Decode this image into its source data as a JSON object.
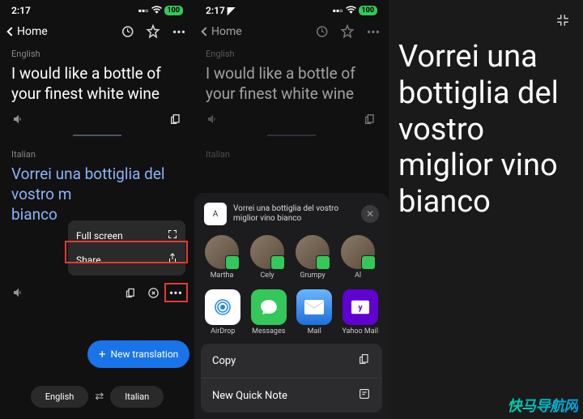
{
  "panel1": {
    "status_time": "2:17",
    "battery": "100",
    "nav_back": "Home",
    "src_lang_label": "English",
    "src_text": "I would like a bottle of your finest white wine",
    "tgt_lang_label": "Italian",
    "tgt_text_visible": "Vorrei una bottiglia del vostro m····· ····· bianco",
    "tgt_text_full": "Vorrei una bottiglia del vostro miglior vino bianco",
    "menu": {
      "fullscreen": "Full screen",
      "share": "Share"
    },
    "new_translation": "New translation",
    "lang_left": "English",
    "lang_right": "Italian"
  },
  "panel2": {
    "status_time": "2:17",
    "battery": "100",
    "nav_back": "Home",
    "src_lang_label": "English",
    "src_text": "I would like a bottle of your finest white wine",
    "tgt_lang_label": "Italian",
    "sheet_title": "Vorrei una bottiglia del vostro miglior vino bianco",
    "contacts": [
      "Martha",
      "Cely",
      "Grumpy",
      "Al"
    ],
    "apps": [
      {
        "name": "AirDrop"
      },
      {
        "name": "Messages"
      },
      {
        "name": "Mail"
      },
      {
        "name": "Yahoo Mail"
      }
    ],
    "action_copy": "Copy",
    "action_quicknote": "New Quick Note"
  },
  "panel3": {
    "fullscreen_text": "Vorrei una bottiglia del vostro miglior vino bianco"
  },
  "watermark": "快马导航网"
}
